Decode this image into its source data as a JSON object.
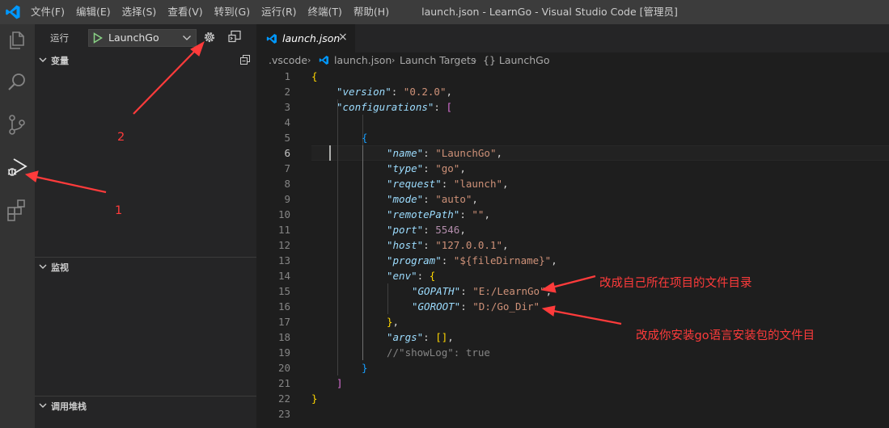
{
  "titlebar": {
    "menus": [
      "文件(F)",
      "编辑(E)",
      "选择(S)",
      "查看(V)",
      "转到(G)",
      "运行(R)",
      "终端(T)",
      "帮助(H)"
    ],
    "window_title": "launch.json - LearnGo - Visual Studio Code [管理员]"
  },
  "activity_bar": {
    "items": [
      {
        "icon": "files-icon"
      },
      {
        "icon": "search-icon"
      },
      {
        "icon": "source-control-icon"
      },
      {
        "icon": "run-debug-icon",
        "active": true
      },
      {
        "icon": "extensions-icon"
      }
    ]
  },
  "sidebar": {
    "run_label": "运行",
    "launch_config": "LaunchGo",
    "sections": {
      "variables": "变量",
      "watch": "监视",
      "call_stack": "调用堆栈"
    }
  },
  "editor": {
    "tab_label": "launch.json",
    "close_glyph": "×",
    "breadcrumbs": [
      ".vscode",
      "launch.json",
      "Launch Targets",
      "{} LaunchGo"
    ],
    "line_numbers": [
      "1",
      "2",
      "3",
      "4",
      "5",
      "6",
      "7",
      "8",
      "9",
      "10",
      "11",
      "12",
      "13",
      "14",
      "15",
      "16",
      "17",
      "18",
      "19",
      "20",
      "21",
      "22",
      "23"
    ],
    "code": {
      "version_key": "\"version\"",
      "version_val": "\"0.2.0\"",
      "configurations_key": "\"configurations\"",
      "name_key": "\"name\"",
      "name_val": "\"LaunchGo\"",
      "type_key": "\"type\"",
      "type_val": "\"go\"",
      "request_key": "\"request\"",
      "request_val": "\"launch\"",
      "mode_key": "\"mode\"",
      "mode_val": "\"auto\"",
      "remotePath_key": "\"remotePath\"",
      "remotePath_val": "\"\"",
      "port_key": "\"port\"",
      "port_val": "5546",
      "host_key": "\"host\"",
      "host_val": "\"127.0.0.1\"",
      "program_key": "\"program\"",
      "program_val": "\"${fileDirname}\"",
      "env_key": "\"env\"",
      "gopath_key": "\"GOPATH\"",
      "gopath_val": "\"E:/LearnGo\"",
      "goroot_key": "\"GOROOT\"",
      "goroot_val": "\"D:/Go_Dir\"",
      "args_key": "\"args\"",
      "args_val": "[]",
      "comment_a": "//\"showLog\"",
      "comment_b": ": true"
    }
  },
  "annotations": {
    "label_1": "1",
    "label_2": "2",
    "note_gopath": "改成自己所在项目的文件目录",
    "note_goroot": "改成你安装go语言安装包的文件目",
    "arrow_color": "#ff3b3b"
  },
  "colors": {
    "titlebar": "#3c3c3c",
    "activity_bar": "#333333",
    "sidebar": "#252526",
    "editor": "#1e1e1e",
    "vscode_blue": "#0098ff"
  }
}
